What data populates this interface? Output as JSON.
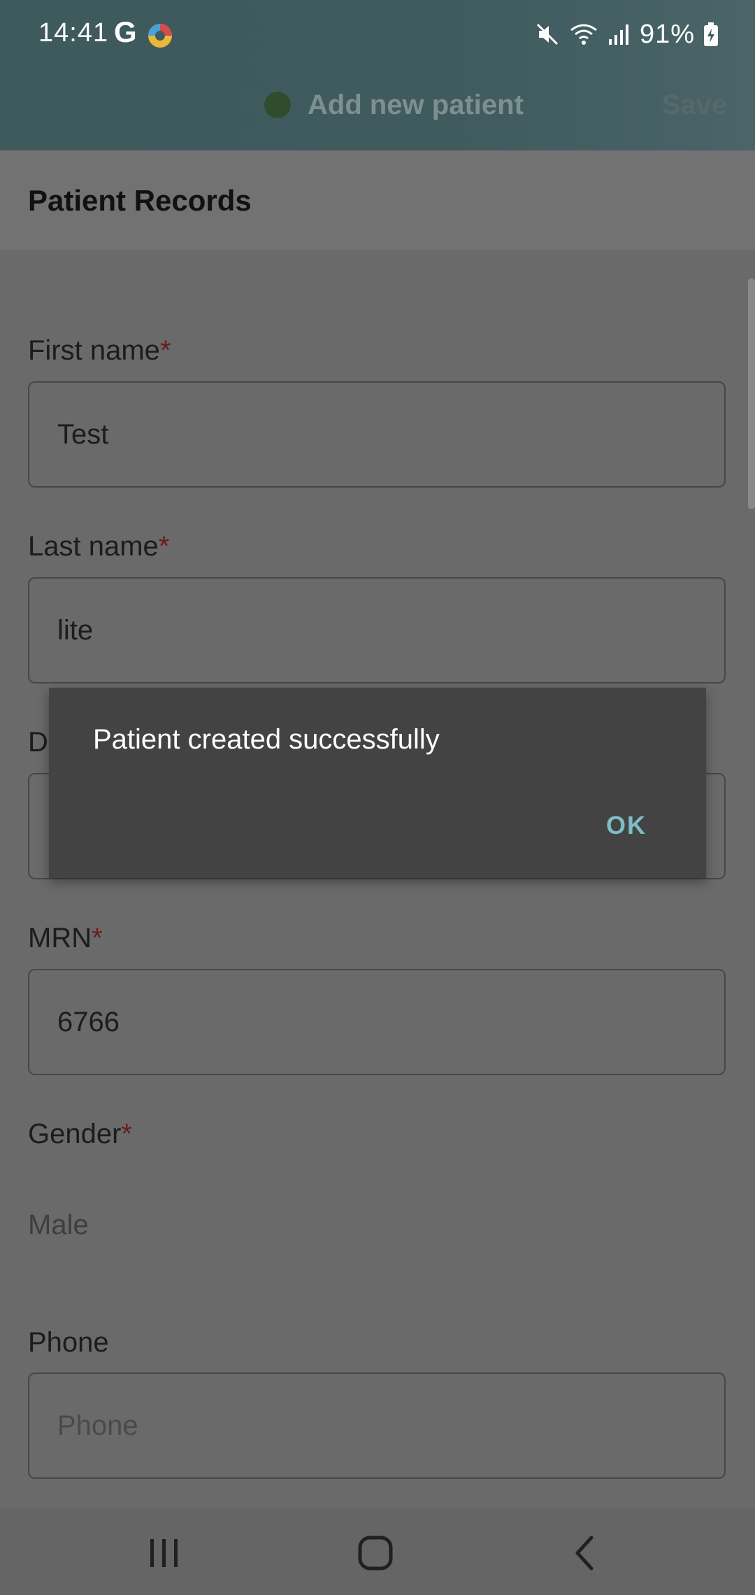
{
  "status_bar": {
    "time": "14:41",
    "g_icon": "G",
    "battery": "91%",
    "icons": [
      "google-icon",
      "app-icon",
      "mute-icon",
      "wifi-icon",
      "signal-icon",
      "battery-charging-icon"
    ]
  },
  "app_bar": {
    "title": "Add new patient",
    "save_label": "Save",
    "status_dot_color": "#2f4d2c"
  },
  "section": {
    "title": "Patient Records"
  },
  "form": {
    "first_name": {
      "label": "First name",
      "required": "*",
      "value": "Test"
    },
    "last_name": {
      "label": "Last name",
      "required": "*",
      "value": "lite"
    },
    "dob": {
      "label_partial": "D"
    },
    "mrn": {
      "label": "MRN",
      "required": "*",
      "value": "6766"
    },
    "gender": {
      "label": "Gender",
      "required": "*",
      "value": "Male"
    },
    "phone": {
      "label": "Phone",
      "placeholder": "Phone"
    }
  },
  "dialog": {
    "message": "Patient created successfully",
    "ok_label": "OK"
  },
  "nav_bar": {
    "buttons": [
      "recents-icon",
      "home-icon",
      "back-icon"
    ]
  },
  "colors": {
    "accent": "#7fbcc4",
    "required": "#6a1d1d",
    "dialog_bg": "#434343"
  }
}
